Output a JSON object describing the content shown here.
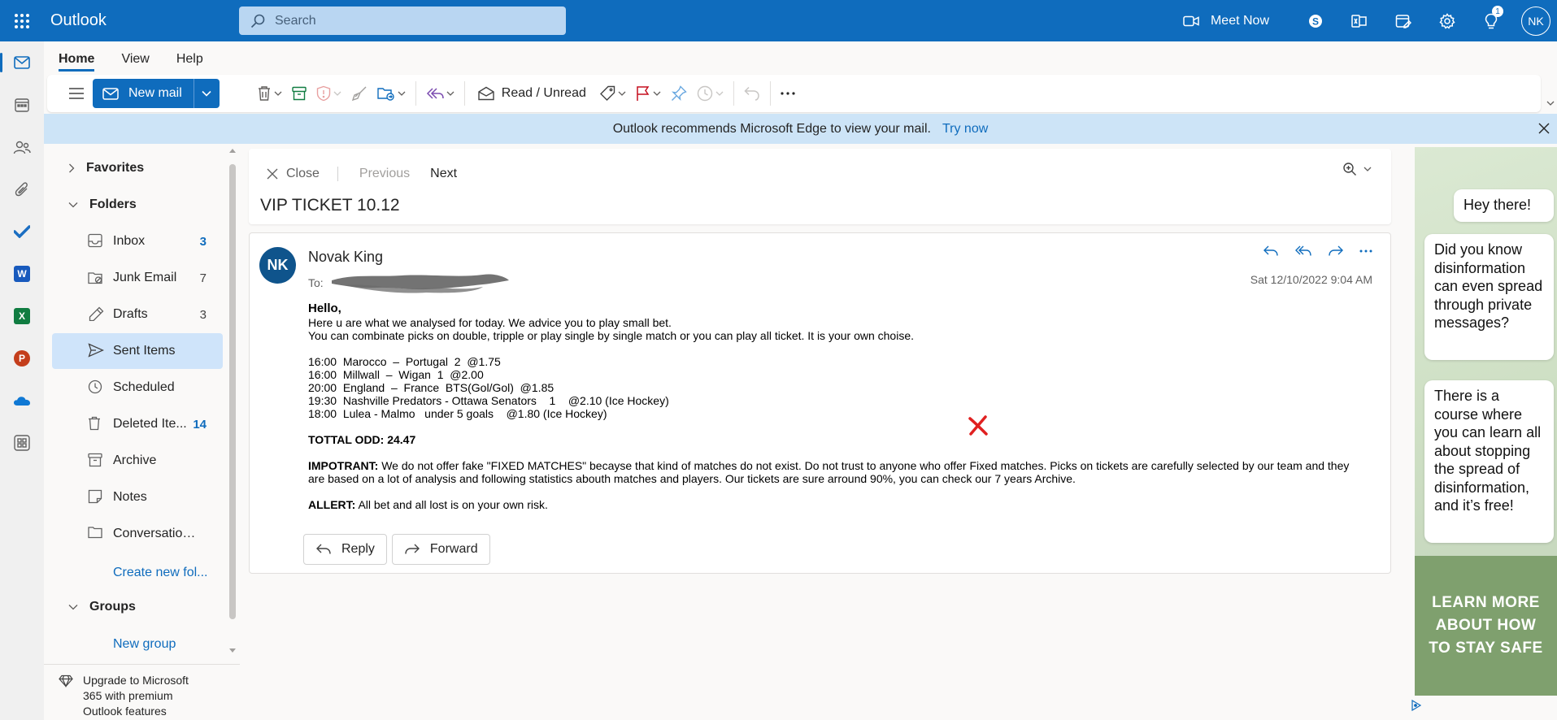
{
  "app": {
    "title": "Outlook",
    "user_initials": "NK",
    "notifications_count": "1"
  },
  "search": {
    "placeholder": "Search"
  },
  "topbar": {
    "meet_now": "Meet Now"
  },
  "ribbon": {
    "tabs": [
      {
        "label": "Home"
      },
      {
        "label": "View"
      },
      {
        "label": "Help"
      }
    ],
    "new_mail": "New mail",
    "read_unread": "Read / Unread"
  },
  "banner": {
    "text": "Outlook recommends Microsoft Edge to view your mail.",
    "link": "Try now"
  },
  "folders": {
    "favorites": "Favorites",
    "folders": "Folders",
    "items": [
      {
        "label": "Inbox",
        "count": "3"
      },
      {
        "label": "Junk Email",
        "count": "7"
      },
      {
        "label": "Drafts",
        "count": "3"
      },
      {
        "label": "Sent Items",
        "count": ""
      },
      {
        "label": "Scheduled",
        "count": ""
      },
      {
        "label": "Deleted Ite...",
        "count": "14"
      },
      {
        "label": "Archive",
        "count": ""
      },
      {
        "label": "Notes",
        "count": ""
      },
      {
        "label": "Conversation ...",
        "count": ""
      }
    ],
    "create_new": "Create new fol...",
    "groups": "Groups",
    "new_group": "New group",
    "upgrade_lines": [
      "Upgrade to Microsoft",
      "365 with premium",
      "Outlook features"
    ]
  },
  "reading": {
    "close": "Close",
    "previous": "Previous",
    "next": "Next",
    "subject": "VIP TICKET 10.12"
  },
  "message": {
    "avatar": "NK",
    "sender": "Novak King",
    "to_label": "To:",
    "date": "Sat 12/10/2022 9:04 AM",
    "greeting": "Hello,",
    "intro1": "Here u are what we analysed for today. We advice you to play small bet.",
    "intro2": "You can combinate picks on double, tripple or play single by single match or you can play all ticket. It is your own choise.",
    "picks": [
      "16:00  Marocco  –  Portugal  2  @1.75",
      "16:00  Millwall  –  Wigan  1  @2.00",
      "20:00  England  –  France  BTS(Gol/Gol)  @1.85",
      "19:30  Nashville Predators - Ottawa Senators    1    @2.10 (Ice Hockey)",
      "18:00  Lulea - Malmo   under 5 goals    @1.80 (Ice Hockey)"
    ],
    "total": "TOTTAL ODD: 24.47",
    "important_label": "IMPOTRANT:",
    "important_text": " We do not offer fake \"FIXED MATCHES\" becayse that kind of matches do not exist. Do not trust to anyone who offer Fixed matches. Picks on tickets are carefully selected by our team and they are based on a lot of analysis and following statistics abouth matches and players. Our tickets are sure arround 90%, you can check our 7 years Archive.",
    "alert_label": "ALLERT:",
    "alert_text": " All bet and all lost is on your own risk.",
    "reply": "Reply",
    "forward": "Forward"
  },
  "ad": {
    "bubble1": "Hey there!",
    "bubble2": "Did you know disinformation can even spread through private messages?",
    "bubble3": "There is a course where you can learn all about stopping the spread of disinformation, and it’s free!",
    "footer": "LEARN MORE ABOUT HOW TO STAY SAFE"
  },
  "colors": {
    "brand": "#0f6cbd",
    "selected": "#cfe4fa",
    "banner": "#cde4f7",
    "ad_green": "#7fa06e",
    "red_x": "#e02020"
  }
}
